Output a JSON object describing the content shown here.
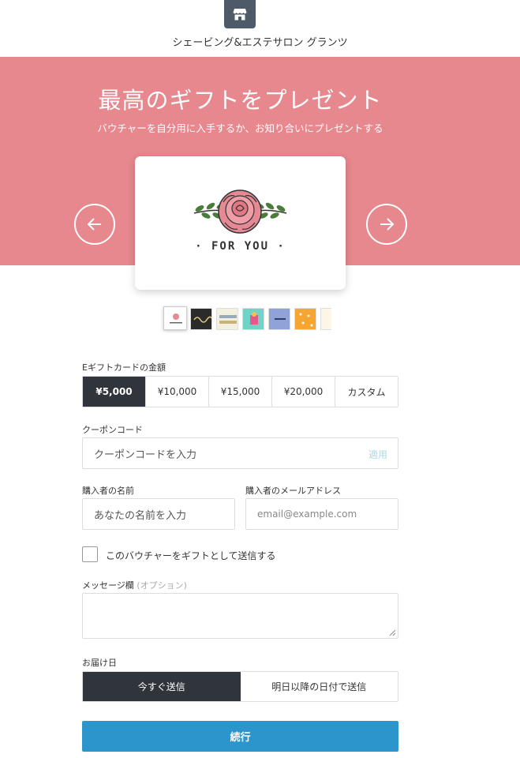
{
  "header": {
    "store_name": "シェービング&エステサロン グランツ",
    "icon": "store-icon"
  },
  "banner": {
    "title": "最高のギフトをプレゼント",
    "subtitle": "バウチャーを自分用に入手するか、お知り合いにプレゼントする",
    "background": "#e6888e"
  },
  "card": {
    "text": "· FOR YOU ·"
  },
  "amount_section": {
    "label": "Eギフトカードの金額",
    "options": [
      "¥5,000",
      "¥10,000",
      "¥15,000",
      "¥20,000",
      "カスタム"
    ],
    "selected": "¥5,000"
  },
  "coupon": {
    "label": "クーポンコード",
    "placeholder": "クーポンコードを入力",
    "apply_label": "適用"
  },
  "buyer": {
    "name_label": "購入者の名前",
    "name_placeholder": "あなたの名前を入力",
    "email_label": "購入者のメールアドレス",
    "email_placeholder": "email@example.com"
  },
  "gift_checkbox": {
    "label": "このバウチャーをギフトとして送信する",
    "checked": false
  },
  "message": {
    "label": "メッセージ欄",
    "optional": "(オプション)"
  },
  "delivery": {
    "label": "お届け日",
    "options": [
      "今すぐ送信",
      "明日以降の日付で送信"
    ],
    "selected": "今すぐ送信"
  },
  "continue_label": "続行",
  "colors": {
    "accent": "#2c95cc",
    "dark": "#30353b",
    "banner": "#e6888e"
  }
}
